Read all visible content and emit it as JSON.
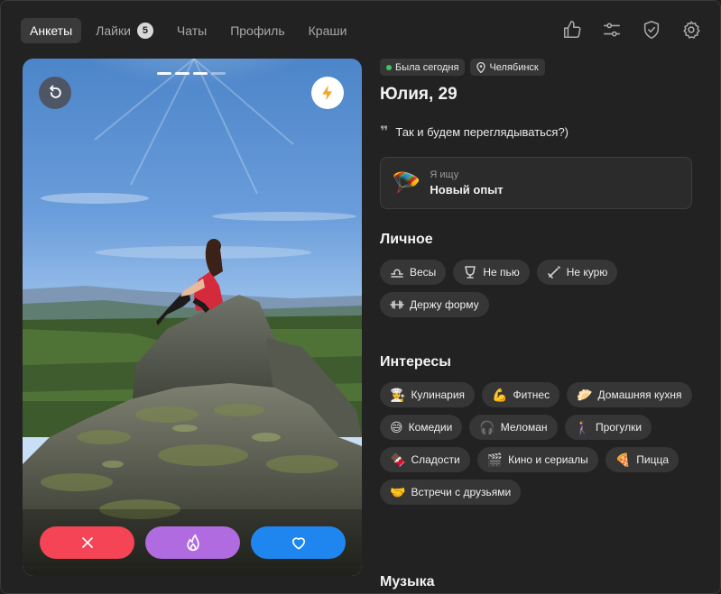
{
  "nav": {
    "tabs": [
      {
        "label": "Анкеты",
        "active": true
      },
      {
        "label": "Лайки",
        "badge": "5"
      },
      {
        "label": "Чаты"
      },
      {
        "label": "Профиль"
      },
      {
        "label": "Краши"
      }
    ],
    "icons": [
      "thumbs-up-icon",
      "sliders-icon",
      "shield-check-icon",
      "gear-icon"
    ]
  },
  "photo": {
    "progress_total": 4,
    "progress_active": 3,
    "buttons": [
      "undo-icon",
      "lightning-icon"
    ],
    "actions": [
      "close-icon",
      "flame-icon",
      "heart-icon"
    ],
    "colors": {
      "dislike": "#f44456",
      "superlike": "#b06be0",
      "like": "#1f86f0",
      "boost": "#f5a623"
    }
  },
  "profile": {
    "status": "Была сегодня",
    "city": "Челябинск",
    "name": "Юлия, 29",
    "quote": "Так и будем переглядываться?)",
    "seeking": {
      "emoji": "🪂",
      "label": "Я ищу",
      "value": "Новый опыт"
    }
  },
  "personal": {
    "title": "Личное",
    "items": [
      {
        "icon": "libra-icon",
        "label": "Весы"
      },
      {
        "icon": "glass-icon",
        "label": "Не пью"
      },
      {
        "icon": "no-smoking-icon",
        "label": "Не курю"
      },
      {
        "icon": "dumbbell-icon",
        "label": "Держу форму"
      }
    ]
  },
  "interests": {
    "title": "Интересы",
    "items": [
      {
        "emoji": "👩‍🍳",
        "label": "Кулинария"
      },
      {
        "emoji": "💪",
        "label": "Фитнес"
      },
      {
        "emoji": "🥟",
        "label": "Домашняя кухня"
      },
      {
        "emoji": "😅",
        "label": "Комедии"
      },
      {
        "emoji": "🎧",
        "label": "Меломан"
      },
      {
        "emoji": "🚶‍♀️",
        "label": "Прогулки"
      },
      {
        "emoji": "🍫",
        "label": "Сладости"
      },
      {
        "emoji": "🎬",
        "label": "Кино и сериалы"
      },
      {
        "emoji": "🍕",
        "label": "Пицца"
      },
      {
        "emoji": "🤝",
        "label": "Встречи с друзьями"
      }
    ]
  },
  "music": {
    "title": "Музыка"
  }
}
